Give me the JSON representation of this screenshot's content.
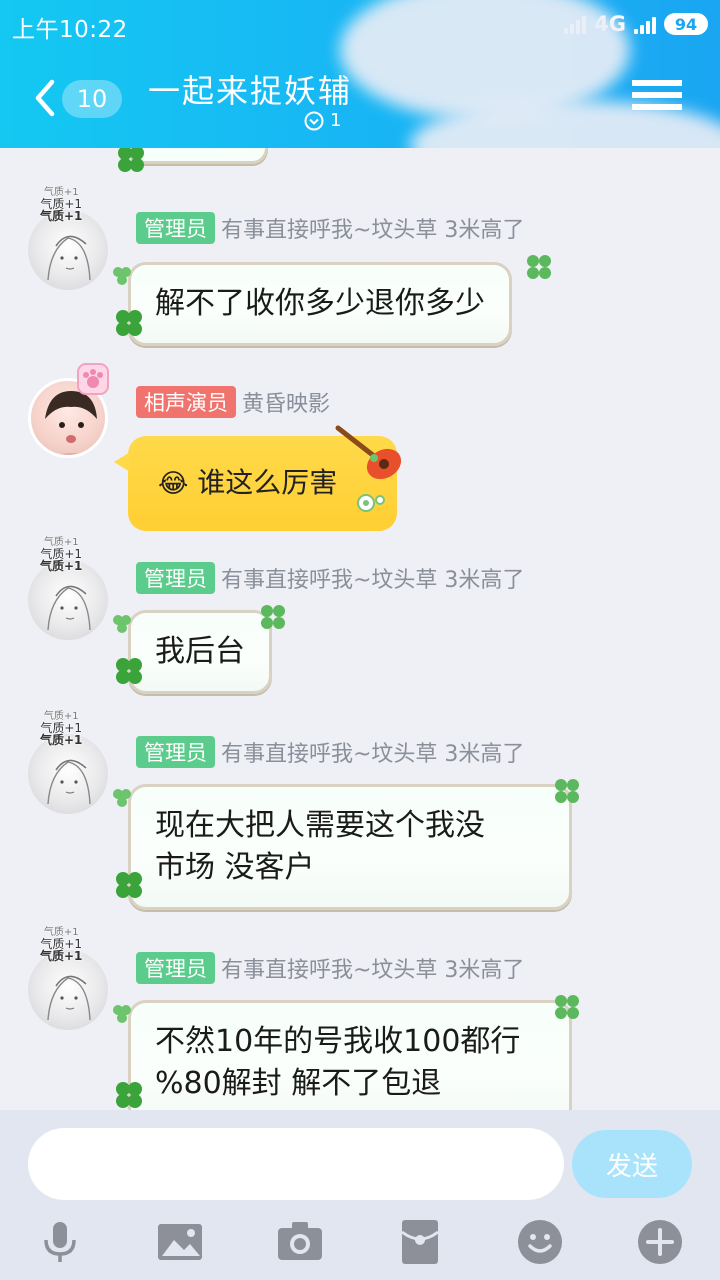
{
  "status_bar": {
    "time": "上午10:22",
    "network": "4G",
    "battery": "94"
  },
  "header": {
    "unread_count": "10",
    "title": "一起来捉妖辅",
    "member_count": "1"
  },
  "messages": [
    {
      "role": "管理员",
      "nickname": "有事直接呼我~坟头草 3米高了",
      "avatar_tags": [
        "气质+1",
        "气质+1",
        "气质+1"
      ],
      "text": "解不了收你多少退你多少"
    },
    {
      "role": "相声演员",
      "nickname": "黄昏映影",
      "emoji": "😂",
      "text": "谁这么厉害"
    },
    {
      "role": "管理员",
      "nickname": "有事直接呼我~坟头草 3米高了",
      "avatar_tags": [
        "气质+1",
        "气质+1",
        "气质+1"
      ],
      "text": "我后台"
    },
    {
      "role": "管理员",
      "nickname": "有事直接呼我~坟头草 3米高了",
      "avatar_tags": [
        "气质+1",
        "气质+1",
        "气质+1"
      ],
      "lines": [
        "现在大把人需要这个我没",
        "市场 没客户"
      ]
    },
    {
      "role": "管理员",
      "nickname": "有事直接呼我~坟头草 3米高了",
      "avatar_tags": [
        "气质+1",
        "气质+1",
        "气质+1"
      ],
      "lines": [
        "不然10年的号我收100都行",
        "%80解封 解不了包退"
      ]
    }
  ],
  "input_bar": {
    "value": "",
    "send_label": "发送",
    "tools": [
      "microphone-icon",
      "image-icon",
      "camera-icon",
      "red-packet-icon",
      "emoji-icon",
      "plus-icon"
    ]
  },
  "colors": {
    "header_start": "#14c8f2",
    "header_end": "#1aa6f2",
    "admin_tag": "#5bcc8c",
    "xs_tag": "#f1736d",
    "yellow_bubble": "#ffd94a",
    "send_button": "#a9e3fb",
    "tool_icon": "#8d9099"
  }
}
